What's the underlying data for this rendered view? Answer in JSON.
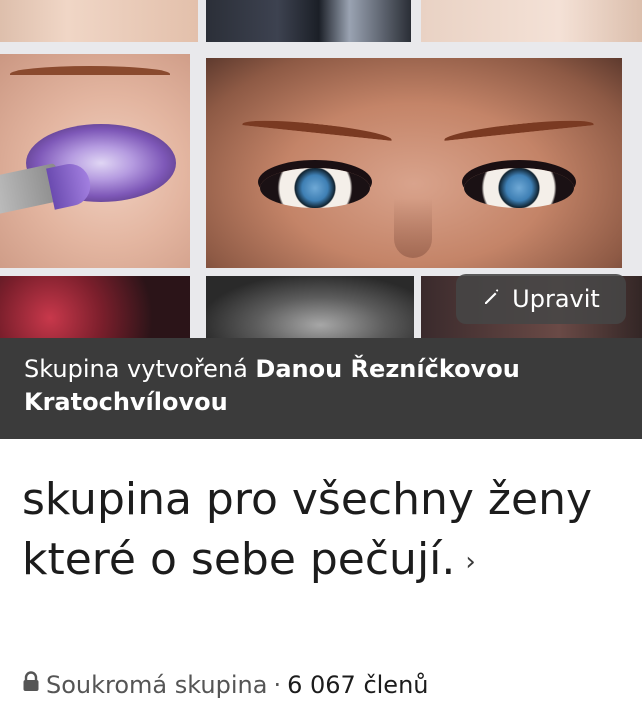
{
  "cover": {
    "edit_label": "Upravit",
    "icons": {
      "edit": "pencil-icon"
    }
  },
  "creator": {
    "prefix": "Skupina vytvořená",
    "name": "Danou Řezníčkovou Kratochvílovou"
  },
  "group": {
    "title": "skupina pro všechny ženy  které o sebe pečují.",
    "chevron": "›",
    "privacy": "Soukromá skupina",
    "separator": "·",
    "members": "6 067 členů"
  },
  "colors": {
    "banner_bg": "#3b3b3b",
    "edit_btn_bg": "#464646"
  }
}
